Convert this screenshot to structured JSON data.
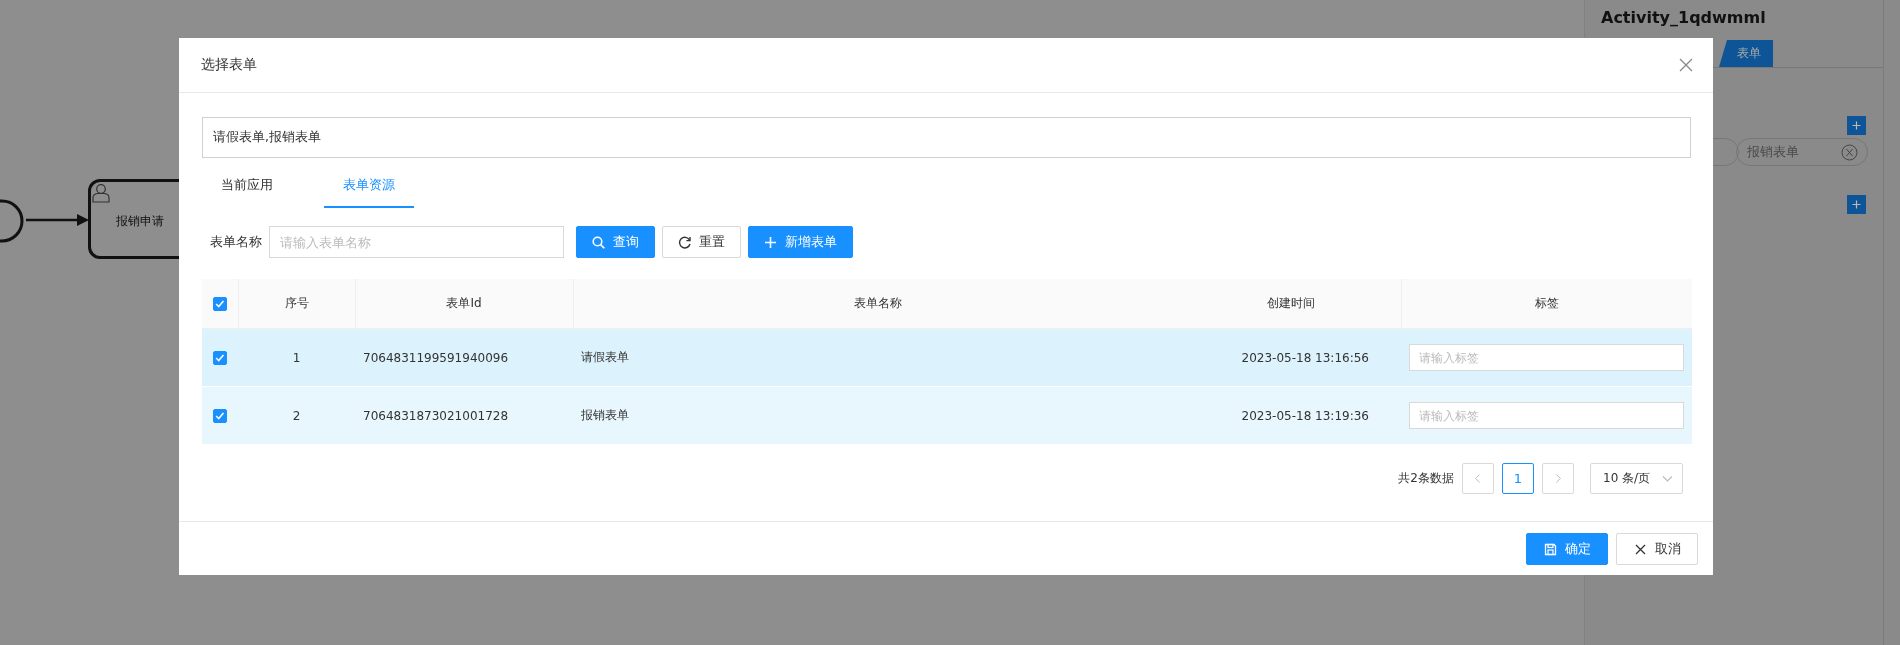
{
  "diagram": {
    "task": {
      "label": "报销申请"
    }
  },
  "properties_panel": {
    "title": "Activity_1qdwmml",
    "tabs": [
      {
        "label": "表单",
        "selected": true
      }
    ],
    "form_tags": [
      {
        "label": "报销表单"
      }
    ]
  },
  "dialog": {
    "title": "选择表单",
    "selection": "请假表单,报销表单",
    "tabs": [
      {
        "label": "当前应用",
        "selected": false
      },
      {
        "label": "表单资源",
        "selected": true
      }
    ],
    "search": {
      "label": "表单名称",
      "placeholder": "请输入表单名称"
    },
    "buttons": [
      {
        "kind": "search",
        "label": "查询"
      },
      {
        "kind": "reset",
        "label": "重置"
      },
      {
        "kind": "add",
        "label": "新增表单"
      }
    ],
    "table": {
      "all_checked": true,
      "columns": [
        "序号",
        "表单Id",
        "表单名称",
        "创建时间",
        "标签"
      ],
      "rows": [
        {
          "checked": true,
          "highlighted": true,
          "cells": [
            "1",
            "7064831199591940096",
            "请假表单",
            "2023-05-18 13:16:56"
          ],
          "tag_placeholder": "请输入标签"
        },
        {
          "checked": true,
          "highlighted": false,
          "cells": [
            "2",
            "7064831873021001728",
            "报销表单",
            "2023-05-18 13:19:36"
          ],
          "tag_placeholder": "请输入标签"
        }
      ]
    },
    "pagination": {
      "total": "共2条数据",
      "pages": [
        {
          "label": "1",
          "selected": true
        }
      ],
      "page_size": "10 条/页"
    },
    "footer_buttons": [
      {
        "kind": "confirm",
        "label": "确定"
      },
      {
        "kind": "cancel",
        "label": "取消"
      }
    ]
  }
}
